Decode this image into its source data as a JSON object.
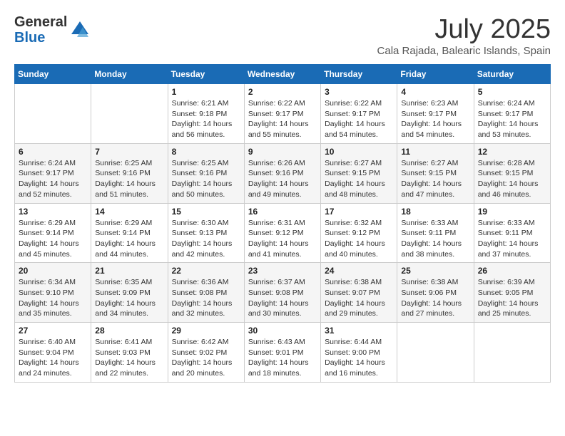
{
  "logo": {
    "general": "General",
    "blue": "Blue"
  },
  "title": {
    "month_year": "July 2025",
    "location": "Cala Rajada, Balearic Islands, Spain"
  },
  "weekdays": [
    "Sunday",
    "Monday",
    "Tuesday",
    "Wednesday",
    "Thursday",
    "Friday",
    "Saturday"
  ],
  "weeks": [
    [
      {
        "day": "",
        "sunrise": "",
        "sunset": "",
        "daylight": ""
      },
      {
        "day": "",
        "sunrise": "",
        "sunset": "",
        "daylight": ""
      },
      {
        "day": "1",
        "sunrise": "Sunrise: 6:21 AM",
        "sunset": "Sunset: 9:18 PM",
        "daylight": "Daylight: 14 hours and 56 minutes."
      },
      {
        "day": "2",
        "sunrise": "Sunrise: 6:22 AM",
        "sunset": "Sunset: 9:17 PM",
        "daylight": "Daylight: 14 hours and 55 minutes."
      },
      {
        "day": "3",
        "sunrise": "Sunrise: 6:22 AM",
        "sunset": "Sunset: 9:17 PM",
        "daylight": "Daylight: 14 hours and 54 minutes."
      },
      {
        "day": "4",
        "sunrise": "Sunrise: 6:23 AM",
        "sunset": "Sunset: 9:17 PM",
        "daylight": "Daylight: 14 hours and 54 minutes."
      },
      {
        "day": "5",
        "sunrise": "Sunrise: 6:24 AM",
        "sunset": "Sunset: 9:17 PM",
        "daylight": "Daylight: 14 hours and 53 minutes."
      }
    ],
    [
      {
        "day": "6",
        "sunrise": "Sunrise: 6:24 AM",
        "sunset": "Sunset: 9:17 PM",
        "daylight": "Daylight: 14 hours and 52 minutes."
      },
      {
        "day": "7",
        "sunrise": "Sunrise: 6:25 AM",
        "sunset": "Sunset: 9:16 PM",
        "daylight": "Daylight: 14 hours and 51 minutes."
      },
      {
        "day": "8",
        "sunrise": "Sunrise: 6:25 AM",
        "sunset": "Sunset: 9:16 PM",
        "daylight": "Daylight: 14 hours and 50 minutes."
      },
      {
        "day": "9",
        "sunrise": "Sunrise: 6:26 AM",
        "sunset": "Sunset: 9:16 PM",
        "daylight": "Daylight: 14 hours and 49 minutes."
      },
      {
        "day": "10",
        "sunrise": "Sunrise: 6:27 AM",
        "sunset": "Sunset: 9:15 PM",
        "daylight": "Daylight: 14 hours and 48 minutes."
      },
      {
        "day": "11",
        "sunrise": "Sunrise: 6:27 AM",
        "sunset": "Sunset: 9:15 PM",
        "daylight": "Daylight: 14 hours and 47 minutes."
      },
      {
        "day": "12",
        "sunrise": "Sunrise: 6:28 AM",
        "sunset": "Sunset: 9:15 PM",
        "daylight": "Daylight: 14 hours and 46 minutes."
      }
    ],
    [
      {
        "day": "13",
        "sunrise": "Sunrise: 6:29 AM",
        "sunset": "Sunset: 9:14 PM",
        "daylight": "Daylight: 14 hours and 45 minutes."
      },
      {
        "day": "14",
        "sunrise": "Sunrise: 6:29 AM",
        "sunset": "Sunset: 9:14 PM",
        "daylight": "Daylight: 14 hours and 44 minutes."
      },
      {
        "day": "15",
        "sunrise": "Sunrise: 6:30 AM",
        "sunset": "Sunset: 9:13 PM",
        "daylight": "Daylight: 14 hours and 42 minutes."
      },
      {
        "day": "16",
        "sunrise": "Sunrise: 6:31 AM",
        "sunset": "Sunset: 9:12 PM",
        "daylight": "Daylight: 14 hours and 41 minutes."
      },
      {
        "day": "17",
        "sunrise": "Sunrise: 6:32 AM",
        "sunset": "Sunset: 9:12 PM",
        "daylight": "Daylight: 14 hours and 40 minutes."
      },
      {
        "day": "18",
        "sunrise": "Sunrise: 6:33 AM",
        "sunset": "Sunset: 9:11 PM",
        "daylight": "Daylight: 14 hours and 38 minutes."
      },
      {
        "day": "19",
        "sunrise": "Sunrise: 6:33 AM",
        "sunset": "Sunset: 9:11 PM",
        "daylight": "Daylight: 14 hours and 37 minutes."
      }
    ],
    [
      {
        "day": "20",
        "sunrise": "Sunrise: 6:34 AM",
        "sunset": "Sunset: 9:10 PM",
        "daylight": "Daylight: 14 hours and 35 minutes."
      },
      {
        "day": "21",
        "sunrise": "Sunrise: 6:35 AM",
        "sunset": "Sunset: 9:09 PM",
        "daylight": "Daylight: 14 hours and 34 minutes."
      },
      {
        "day": "22",
        "sunrise": "Sunrise: 6:36 AM",
        "sunset": "Sunset: 9:08 PM",
        "daylight": "Daylight: 14 hours and 32 minutes."
      },
      {
        "day": "23",
        "sunrise": "Sunrise: 6:37 AM",
        "sunset": "Sunset: 9:08 PM",
        "daylight": "Daylight: 14 hours and 30 minutes."
      },
      {
        "day": "24",
        "sunrise": "Sunrise: 6:38 AM",
        "sunset": "Sunset: 9:07 PM",
        "daylight": "Daylight: 14 hours and 29 minutes."
      },
      {
        "day": "25",
        "sunrise": "Sunrise: 6:38 AM",
        "sunset": "Sunset: 9:06 PM",
        "daylight": "Daylight: 14 hours and 27 minutes."
      },
      {
        "day": "26",
        "sunrise": "Sunrise: 6:39 AM",
        "sunset": "Sunset: 9:05 PM",
        "daylight": "Daylight: 14 hours and 25 minutes."
      }
    ],
    [
      {
        "day": "27",
        "sunrise": "Sunrise: 6:40 AM",
        "sunset": "Sunset: 9:04 PM",
        "daylight": "Daylight: 14 hours and 24 minutes."
      },
      {
        "day": "28",
        "sunrise": "Sunrise: 6:41 AM",
        "sunset": "Sunset: 9:03 PM",
        "daylight": "Daylight: 14 hours and 22 minutes."
      },
      {
        "day": "29",
        "sunrise": "Sunrise: 6:42 AM",
        "sunset": "Sunset: 9:02 PM",
        "daylight": "Daylight: 14 hours and 20 minutes."
      },
      {
        "day": "30",
        "sunrise": "Sunrise: 6:43 AM",
        "sunset": "Sunset: 9:01 PM",
        "daylight": "Daylight: 14 hours and 18 minutes."
      },
      {
        "day": "31",
        "sunrise": "Sunrise: 6:44 AM",
        "sunset": "Sunset: 9:00 PM",
        "daylight": "Daylight: 14 hours and 16 minutes."
      },
      {
        "day": "",
        "sunrise": "",
        "sunset": "",
        "daylight": ""
      },
      {
        "day": "",
        "sunrise": "",
        "sunset": "",
        "daylight": ""
      }
    ]
  ]
}
